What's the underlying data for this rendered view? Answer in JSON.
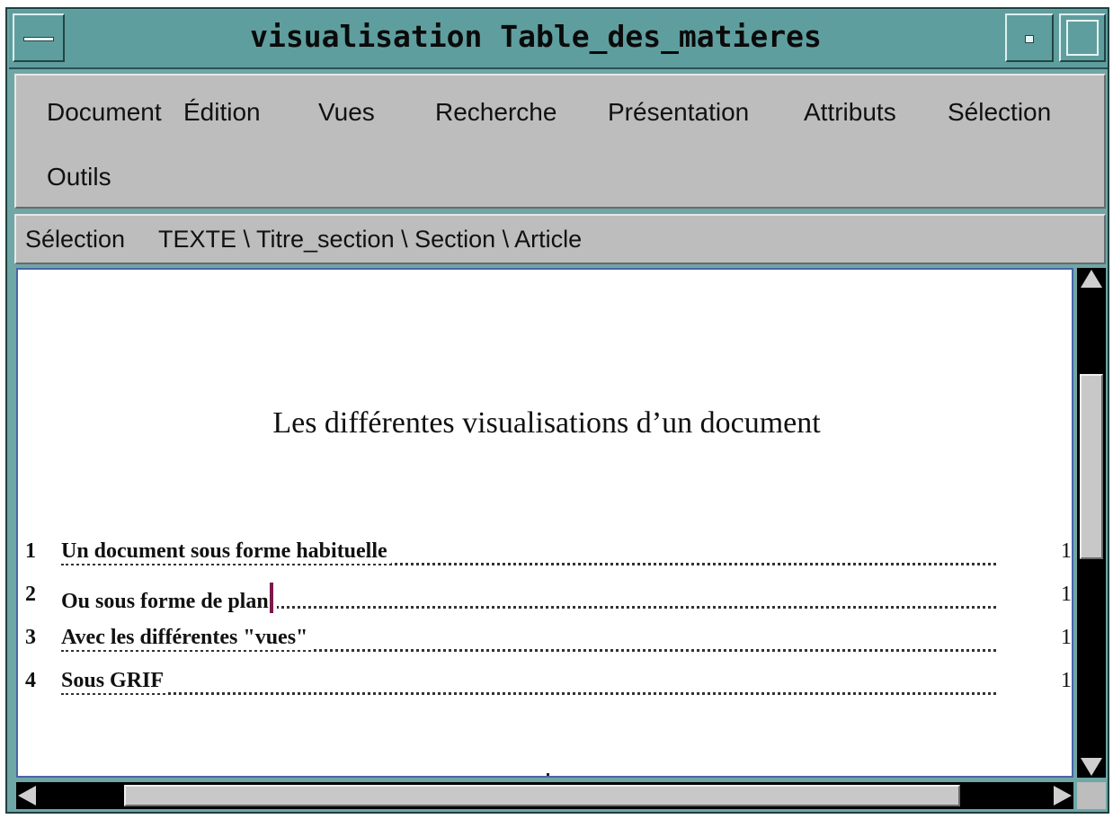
{
  "window": {
    "title": "visualisation  Table_des_matieres",
    "menu_button_icon": "window-menu-icon",
    "minimize_icon": "minimize-icon",
    "maximize_icon": "maximize-icon"
  },
  "menubar": {
    "items": [
      {
        "label": "Document"
      },
      {
        "label": "Édition"
      },
      {
        "label": "Vues"
      },
      {
        "label": "Recherche"
      },
      {
        "label": "Présentation"
      },
      {
        "label": "Attributs"
      },
      {
        "label": "Sélection"
      },
      {
        "label": "Outils"
      }
    ]
  },
  "selection_bar": {
    "label": "Sélection",
    "path": "TEXTE \\ Titre_section \\ Section \\ Article"
  },
  "document": {
    "title": "Les différentes visualisations d’un document",
    "toc": [
      {
        "num": "1",
        "text": "Un document sous forme habituelle",
        "page": "1"
      },
      {
        "num": "2",
        "text": "Ou sous forme de plan",
        "page": "1"
      },
      {
        "num": "3",
        "text": "Avec les différentes \"vues\"",
        "page": "1"
      },
      {
        "num": "4",
        "text": "Sous GRIF",
        "page": "1"
      }
    ]
  },
  "colors": {
    "titlebar": "#5f9e9e",
    "chrome": "#bdbdbd",
    "caret": "#7a1a4a",
    "doc_border": "#4a64a8"
  }
}
